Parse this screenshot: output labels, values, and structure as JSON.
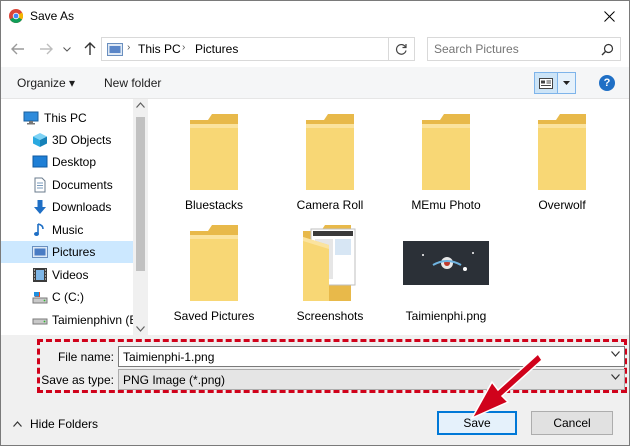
{
  "window": {
    "title": "Save As",
    "close_icon": "close-icon"
  },
  "navbar": {
    "breadcrumb": [
      "This PC",
      "Pictures"
    ],
    "search_placeholder": "Search Pictures"
  },
  "toolbar": {
    "organize_label": "Organize ▾",
    "new_folder_label": "New folder",
    "help_label": "?"
  },
  "sidebar": {
    "items": [
      {
        "label": "This PC",
        "icon": "computer-icon",
        "selected": false
      },
      {
        "label": "3D Objects",
        "icon": "cube-icon",
        "selected": false
      },
      {
        "label": "Desktop",
        "icon": "desktop-icon",
        "selected": false
      },
      {
        "label": "Documents",
        "icon": "document-icon",
        "selected": false
      },
      {
        "label": "Downloads",
        "icon": "download-arrow-icon",
        "selected": false
      },
      {
        "label": "Music",
        "icon": "music-note-icon",
        "selected": false
      },
      {
        "label": "Pictures",
        "icon": "pictures-icon",
        "selected": true
      },
      {
        "label": "Videos",
        "icon": "film-icon",
        "selected": false
      },
      {
        "label": "C (C:)",
        "icon": "drive-icon",
        "selected": false
      },
      {
        "label": "Taimienphivn (E:",
        "icon": "drive-icon",
        "selected": false
      }
    ]
  },
  "files": [
    {
      "name": "Bluestacks",
      "type": "folder"
    },
    {
      "name": "Camera Roll",
      "type": "folder"
    },
    {
      "name": "MEmu Photo",
      "type": "folder"
    },
    {
      "name": "Overwolf",
      "type": "folder"
    },
    {
      "name": "Saved Pictures",
      "type": "folder"
    },
    {
      "name": "Screenshots",
      "type": "folder-with-content"
    },
    {
      "name": "Taimienphi.png",
      "type": "image"
    }
  ],
  "form": {
    "file_name_label": "File name:",
    "file_name_value": "Taimienphi-1.png",
    "save_type_label": "Save as type:",
    "save_type_value": "PNG Image (*.png)"
  },
  "footer": {
    "hide_folders_label": "Hide Folders",
    "save_label": "Save",
    "cancel_label": "Cancel"
  },
  "colors": {
    "annotation_red": "#d0021b",
    "selection_blue": "#cce8ff",
    "folder_yellow": "#f8d775"
  }
}
